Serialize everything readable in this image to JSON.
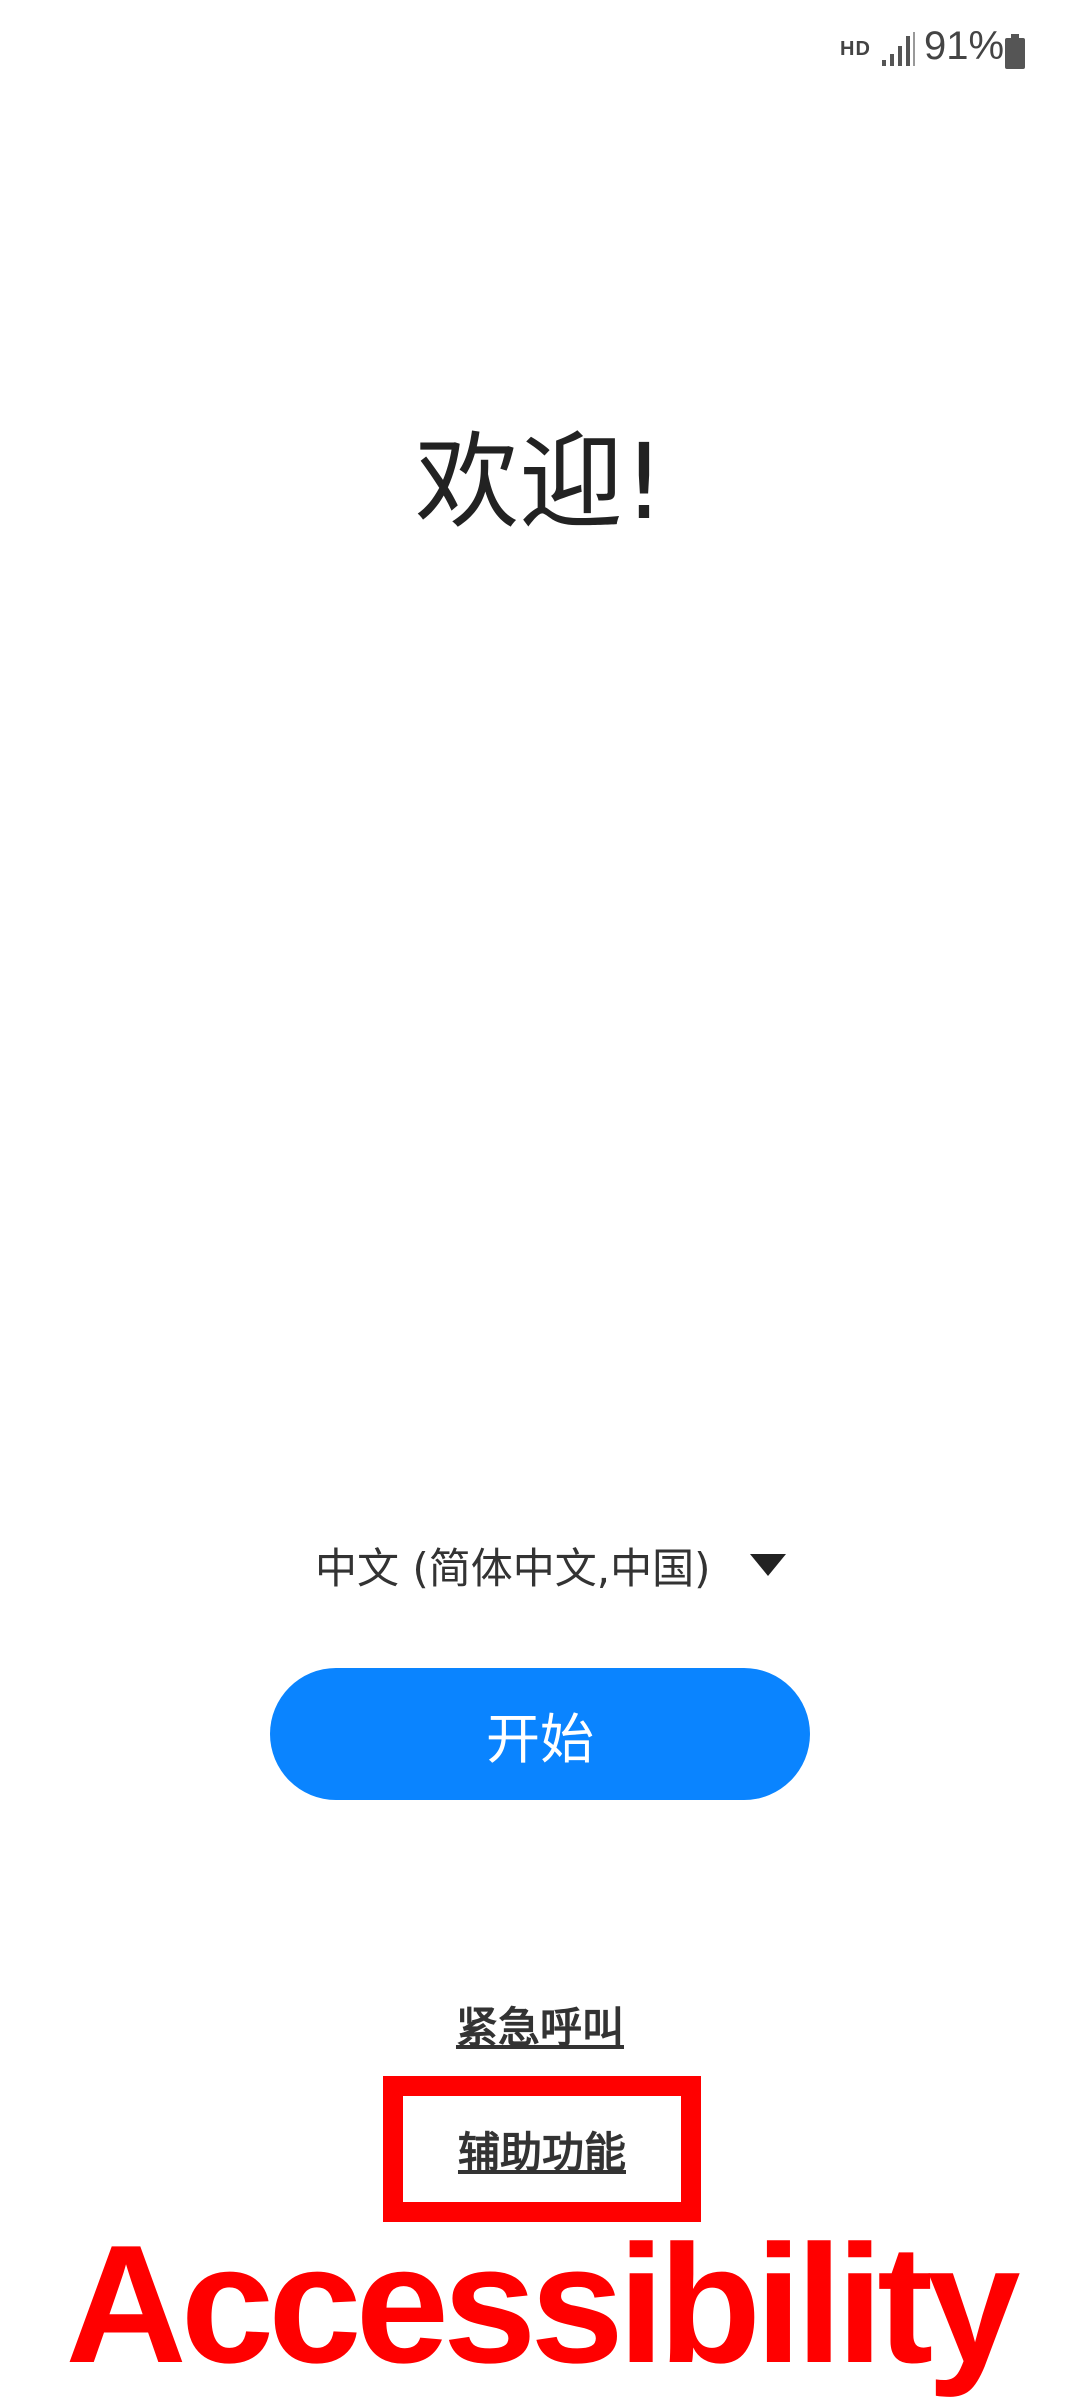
{
  "status_bar": {
    "network_badge": "HD",
    "battery_percent": "91%",
    "icons": [
      "signal-icon",
      "battery-icon"
    ]
  },
  "welcome": {
    "title": "欢迎!"
  },
  "language": {
    "selected": "中文 (简体中文,中国)",
    "icon": "triangle-down-icon"
  },
  "start": {
    "label": "开始"
  },
  "links": {
    "emergency_call": "紧急呼叫",
    "accessibility": "辅助功能"
  },
  "annotation": {
    "text": "Accessibility",
    "color": "#ff0000"
  },
  "colors": {
    "primary_button": "#0a84ff",
    "highlight": "#ff0000",
    "text": "#222222"
  }
}
